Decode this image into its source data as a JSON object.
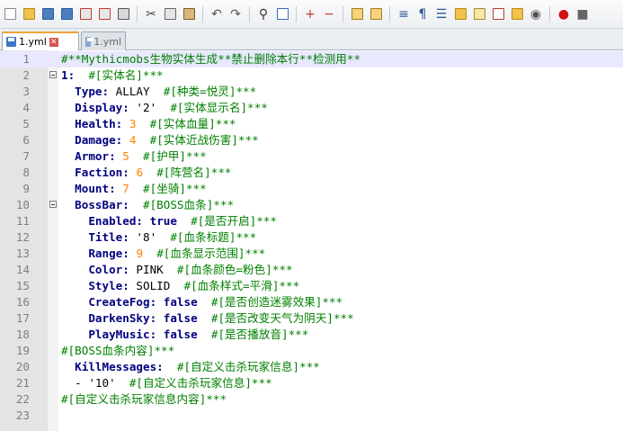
{
  "toolbar": {
    "buttons": [
      "new-file-icon",
      "open-folder-icon",
      "save-icon",
      "save-all-icon",
      "close-icon",
      "close-all-icon",
      "print-icon",
      "cut-icon",
      "copy-icon",
      "paste-icon",
      "undo-icon",
      "redo-icon",
      "find-icon",
      "replace-icon",
      "zoom-in-icon",
      "zoom-out-icon",
      "sync-vertical-icon",
      "sync-horizontal-icon",
      "word-wrap-icon",
      "show-all-chars-icon",
      "indent-guide-icon",
      "user-language-icon",
      "document-map-icon",
      "function-list-icon",
      "folder-as-workspace-icon",
      "monitoring-icon",
      "record-macro-icon",
      "stop-record-icon"
    ]
  },
  "tabs": [
    {
      "label": "1.yml",
      "active": true
    },
    {
      "label": "1.yml",
      "active": false
    }
  ],
  "editor": {
    "lines": [
      {
        "n": "1",
        "text": "#**Mythicmobs生物实体生成**禁止删除本行**检测用**"
      },
      {
        "n": "2",
        "text": "1:  #[实体名]***"
      },
      {
        "n": "3",
        "text": "  Type: ALLAY  #[种类=悦灵]***"
      },
      {
        "n": "4",
        "text": "  Display: '2'  #[实体显示名]***"
      },
      {
        "n": "5",
        "text": "  Health: 3  #[实体血量]***"
      },
      {
        "n": "6",
        "text": "  Damage: 4  #[实体近战伤害]***"
      },
      {
        "n": "7",
        "text": "  Armor: 5  #[护甲]***"
      },
      {
        "n": "8",
        "text": "  Faction: 6  #[阵营名]***"
      },
      {
        "n": "9",
        "text": "  Mount: 7  #[坐骑]***"
      },
      {
        "n": "10",
        "text": "  BossBar:  #[BOSS血条]***"
      },
      {
        "n": "11",
        "text": "    Enabled: true  #[是否开启]***"
      },
      {
        "n": "12",
        "text": "    Title: '8'  #[血条标题]***"
      },
      {
        "n": "13",
        "text": "    Range: 9  #[血条显示范围]***"
      },
      {
        "n": "14",
        "text": "    Color: PINK  #[血条颜色=粉色]***"
      },
      {
        "n": "15",
        "text": "    Style: SOLID  #[血条样式=平滑]***"
      },
      {
        "n": "16",
        "text": "    CreateFog: false  #[是否创造迷雾效果]***"
      },
      {
        "n": "17",
        "text": "    DarkenSky: false  #[是否改变天气为阴天]***"
      },
      {
        "n": "18",
        "text": "    PlayMusic: false  #[是否播放音]***"
      },
      {
        "n": "19",
        "text": "#[BOSS血条内容]***"
      },
      {
        "n": "20",
        "text": "  KillMessages:  #[自定义击杀玩家信息]***"
      },
      {
        "n": "21",
        "text": "  - '10'  #[自定义击杀玩家信息]***"
      },
      {
        "n": "22",
        "text": "#[自定义击杀玩家信息内容]***"
      },
      {
        "n": "23",
        "text": ""
      }
    ]
  }
}
